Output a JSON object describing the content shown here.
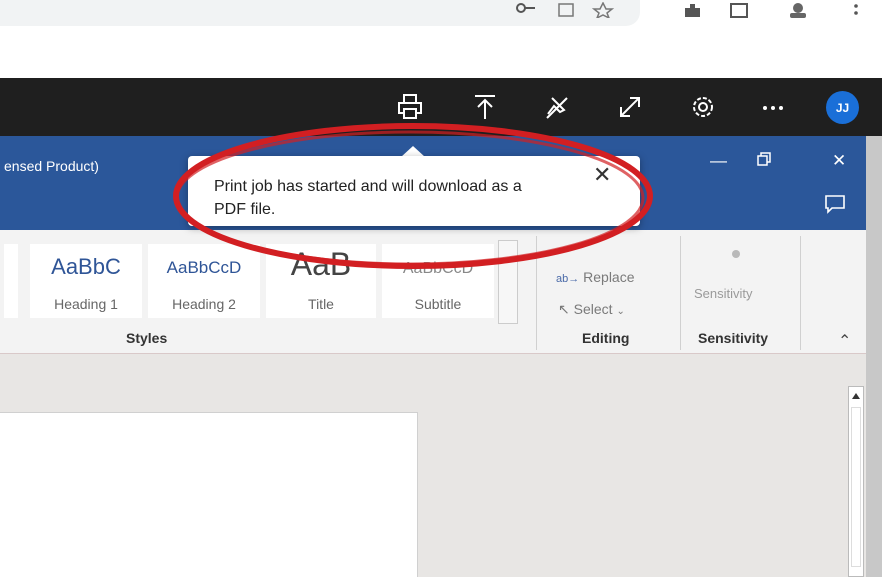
{
  "office_bar": {
    "icons": [
      "printer-icon",
      "upload-icon",
      "pin-off-icon",
      "expand-icon",
      "settings-icon",
      "more-icon"
    ],
    "avatar_initials": "JJ"
  },
  "word": {
    "title_fragment": "ensed Product)"
  },
  "ribbon": {
    "styles": [
      {
        "preview": "AaBbC",
        "name": "Heading 1"
      },
      {
        "preview": "AaBbCcD",
        "name": "Heading 2"
      },
      {
        "preview": "AaB",
        "name": "Title"
      },
      {
        "preview": "AaBbCcD",
        "name": "Subtitle"
      }
    ],
    "styles_group_label": "Styles",
    "editing": {
      "replace_label": "Replace",
      "select_label": "Select",
      "group_label": "Editing"
    },
    "sensitivity": {
      "button_label": "Sensitivity",
      "group_label": "Sensitivity"
    }
  },
  "tooltip": {
    "message": "Print job has started and will download as a PDF file.",
    "close_icon": "close-icon"
  },
  "colors": {
    "office_bar": "#1f1f1f",
    "title_bar": "#2b579a",
    "avatar": "#1a6fd8",
    "annotation": "#d21f22"
  }
}
